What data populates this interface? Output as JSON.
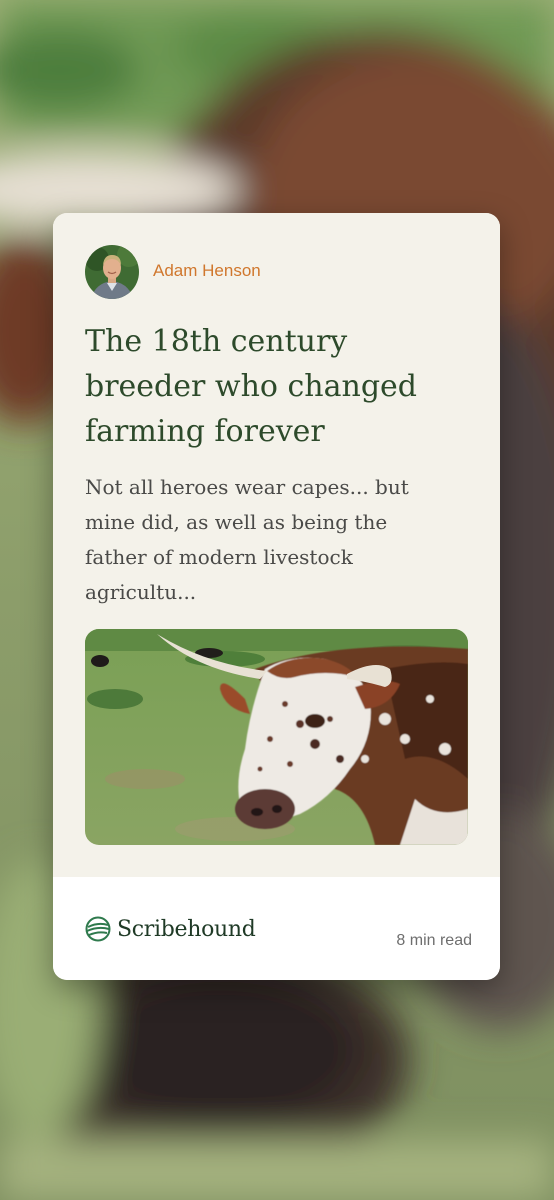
{
  "card": {
    "author": {
      "name": "Adam Henson"
    },
    "title": "The 18th century breeder who changed farming forever",
    "excerpt": "Not all heroes wear capes... but mine did, as well as being the father of modern livestock agricultu...",
    "footer": {
      "brand": "Scribehound",
      "read_time": "8 min read"
    }
  },
  "colors": {
    "card_background": "#f4f2ea",
    "author_accent": "#d0772d",
    "headline": "#2d4a2b",
    "brand": "#1f3a26"
  },
  "icons": {
    "brand_logo": "scribehound-globe-icon"
  }
}
